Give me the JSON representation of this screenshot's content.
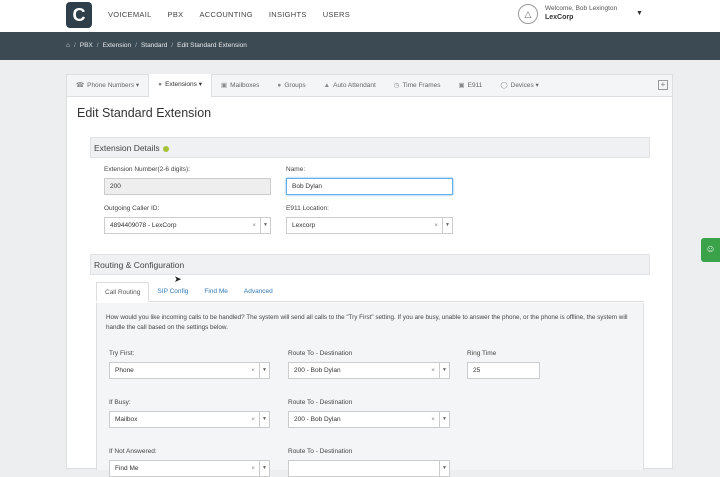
{
  "topnav": {
    "logo_letter": "C",
    "items": [
      "VOICEMAIL",
      "PBX",
      "ACCOUNTING",
      "INSIGHTS",
      "USERS"
    ]
  },
  "user": {
    "welcome": "Welcome, Bob Lexington",
    "company": "LexCorp"
  },
  "breadcrumb": {
    "home_icon": "home-icon",
    "items": [
      "PBX",
      "Extension",
      "Standard",
      "Edit Standard Extension"
    ]
  },
  "tabs": [
    {
      "label": "Phone Numbers",
      "icon": "phone-icon",
      "caret": true
    },
    {
      "label": "Extensions",
      "icon": "users-icon",
      "caret": true
    },
    {
      "label": "Mailboxes",
      "icon": "mailbox-icon"
    },
    {
      "label": "Groups",
      "icon": "groups-icon"
    },
    {
      "label": "Auto Attendant",
      "icon": "person-icon"
    },
    {
      "label": "Time Frames",
      "icon": "clock-icon"
    },
    {
      "label": "E911",
      "icon": "car-icon"
    },
    {
      "label": "Devices",
      "icon": "devices-icon",
      "caret": true
    }
  ],
  "page_title": "Edit Standard Extension",
  "extension_details": {
    "heading": "Extension Details",
    "ext_number_label": "Extension Number(2-6 digits):",
    "ext_number_value": "200",
    "name_label": "Name:",
    "name_value": "Bob Dylan",
    "caller_id_label": "Outgoing Caller ID:",
    "caller_id_value": "4894409078 - LexCorp",
    "e911_label": "E911 Location:",
    "e911_value": "Lexcorp"
  },
  "routing": {
    "heading": "Routing & Configuration",
    "subtabs": [
      "Call Routing",
      "SIP Config",
      "Find Me",
      "Advanced"
    ],
    "intro": "How would you like incoming calls to be handled? The system will send all calls to the \"Try First\" setting. If you are busy, unable to answer the phone, or the phone is offline, the system will handle the call based on the settings below.",
    "try_first_label": "Try First:",
    "try_first_value": "Phone",
    "route_label": "Route To - Destination",
    "route1_value": "200 - Bob Dylan",
    "ring_time_label": "Ring Time",
    "ring_time_value": "25",
    "if_busy_label": "If Busy:",
    "if_busy_value": "Mailbox",
    "route2_value": "200 - Bob Dylan",
    "if_not_answered_label": "If Not Answered:",
    "if_not_answered_value": "Find Me",
    "route3_value": ""
  },
  "colors": {
    "topbar_dark": "#3c4a54",
    "logo": "#2e3f4b",
    "link": "#337ab7",
    "status_dot": "#a6c13a",
    "feedback": "#3aa34a"
  }
}
